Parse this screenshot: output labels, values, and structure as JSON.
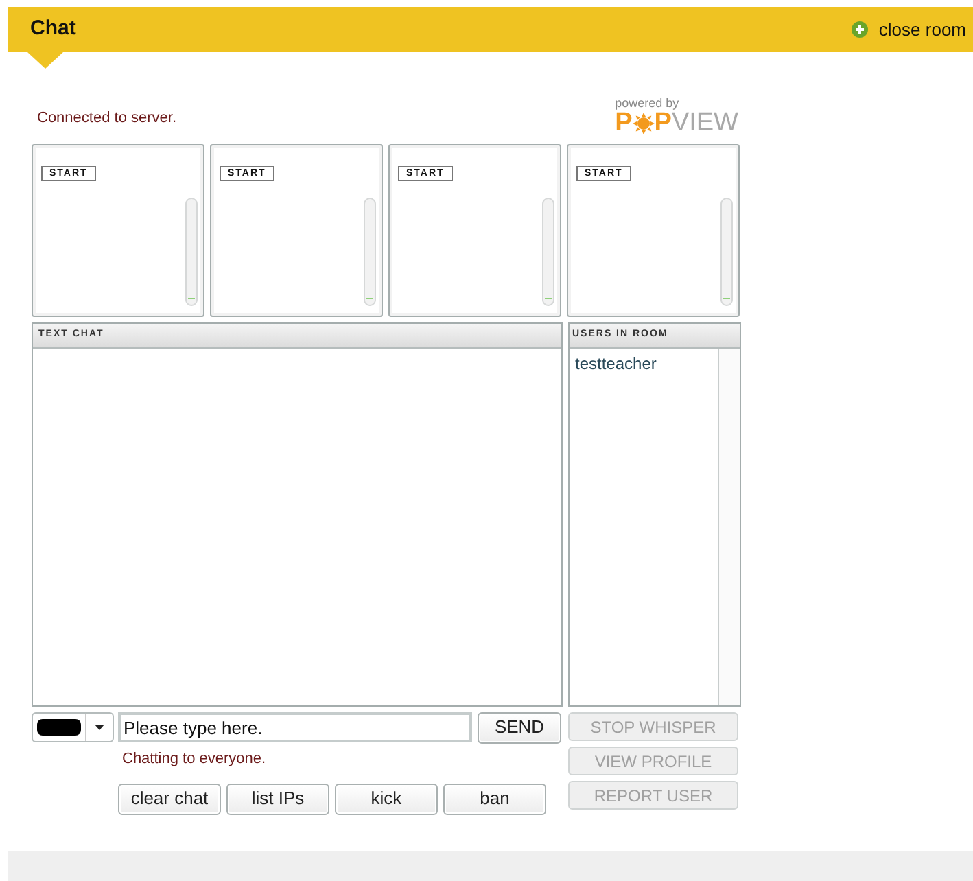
{
  "header": {
    "title": "Chat",
    "action": "close room"
  },
  "status": "Connected to server.",
  "logo": {
    "caption": "powered by",
    "brand_accent": "P",
    "brand_accent_end": "P",
    "brand_rest": "VIEW"
  },
  "video_tiles": [
    {
      "button": "START",
      "level": 0
    },
    {
      "button": "START",
      "level": 0
    },
    {
      "button": "START",
      "level": 0
    },
    {
      "button": "START",
      "level": 0
    }
  ],
  "text_chat": {
    "title": "TEXT CHAT"
  },
  "users": {
    "title": "USERS IN ROOM",
    "items": [
      "testteacher"
    ]
  },
  "message": {
    "placeholder": "Please type here.",
    "send": "SEND"
  },
  "chat_target": "Chatting to everyone.",
  "moderation_buttons": [
    "clear chat",
    "list IPs",
    "kick",
    "ban"
  ],
  "user_actions": [
    {
      "label": "STOP WHISPER",
      "disabled": true
    },
    {
      "label": "VIEW PROFILE",
      "disabled": true
    },
    {
      "label": "REPORT USER",
      "disabled": true
    }
  ]
}
